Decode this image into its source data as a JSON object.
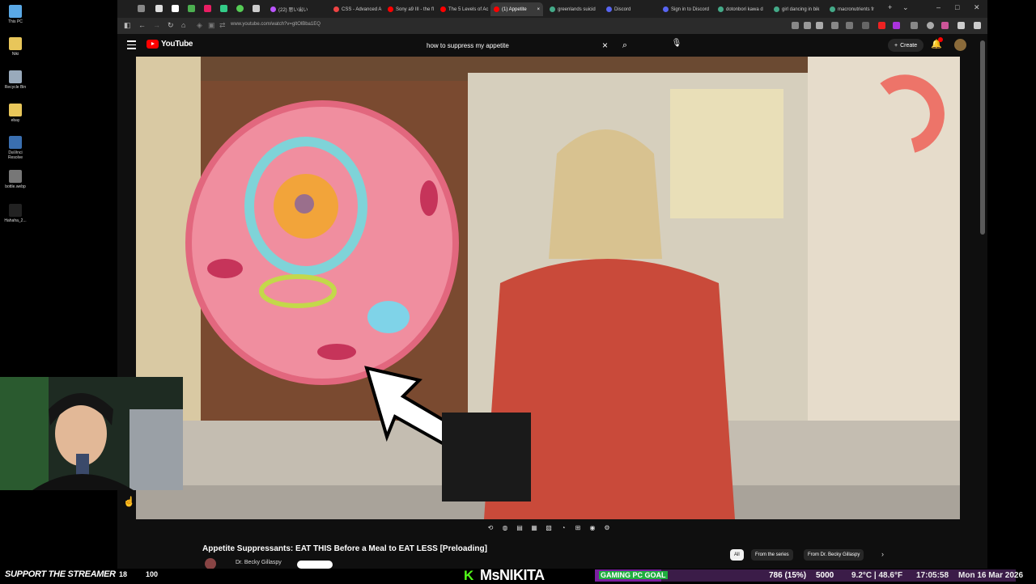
{
  "desktop": {
    "icons": [
      {
        "label": "This PC",
        "color": "#5aa9e6"
      },
      {
        "label": "Niki",
        "color": "#e8c65a"
      },
      {
        "label": "Recycle Bin",
        "color": "#9ab"
      },
      {
        "label": "ebay",
        "color": "#e8c65a"
      },
      {
        "label": "DaVinci Resolve",
        "color": "#3a6fb0"
      },
      {
        "label": "bottle.webp",
        "color": "#777"
      },
      {
        "label": "Hahaha_2...",
        "color": "#222"
      }
    ]
  },
  "browser": {
    "tabs": [
      {
        "label": "CSS - Advanced A",
        "color": "#e44"
      },
      {
        "label": "Sony a9 III - the fl",
        "color": "#f00"
      },
      {
        "label": "The 5 Levels of Ac",
        "color": "#f00"
      },
      {
        "label": "(1) Appetite",
        "color": "#f00",
        "active": true
      },
      {
        "label": "greenlands suicid",
        "color": "#4a8"
      },
      {
        "label": "Discord",
        "color": "#5865f2"
      },
      {
        "label": "Sign in to Discord",
        "color": "#5865f2"
      },
      {
        "label": "dotonbori kawa d",
        "color": "#4a8"
      },
      {
        "label": "girl dancing in bik",
        "color": "#4a8"
      },
      {
        "label": "macronutrients fr",
        "color": "#4a8"
      }
    ],
    "pinned_tab_label": "(22) 思い出い",
    "url": "www.youtube.com/watch?v=gltOlBba1EQ"
  },
  "youtube": {
    "logo_text": "YouTube",
    "search_query": "how to suppress my appetite",
    "create_label": "Create",
    "video_title": "Appetite Suppressants: EAT THIS Before a Meal to EAT LESS [Preloading]",
    "channel_name": "Dr. Becky Gillaspy",
    "chips": [
      "All",
      "From the series",
      "From Dr. Becky Gillaspy"
    ]
  },
  "stream": {
    "support_text": "SUPPORT THE STREAMER",
    "sub_count": "18",
    "sub_target": "100",
    "streamer_name": "MsNIKITA",
    "goal_label": "GAMING PC GOAL",
    "goal_current": "786 (15%)",
    "goal_target": "5000",
    "goal_progress": 0.157
  },
  "taskbar": {
    "weather": "9.2°C | 48.6°F",
    "clock": "17:05:58",
    "date": "Mon 16 Mar 2026"
  },
  "colors": {
    "youtube_red": "#ff0000",
    "kick_green": "#53fc18",
    "goal_purple": "#7a1e9e"
  }
}
